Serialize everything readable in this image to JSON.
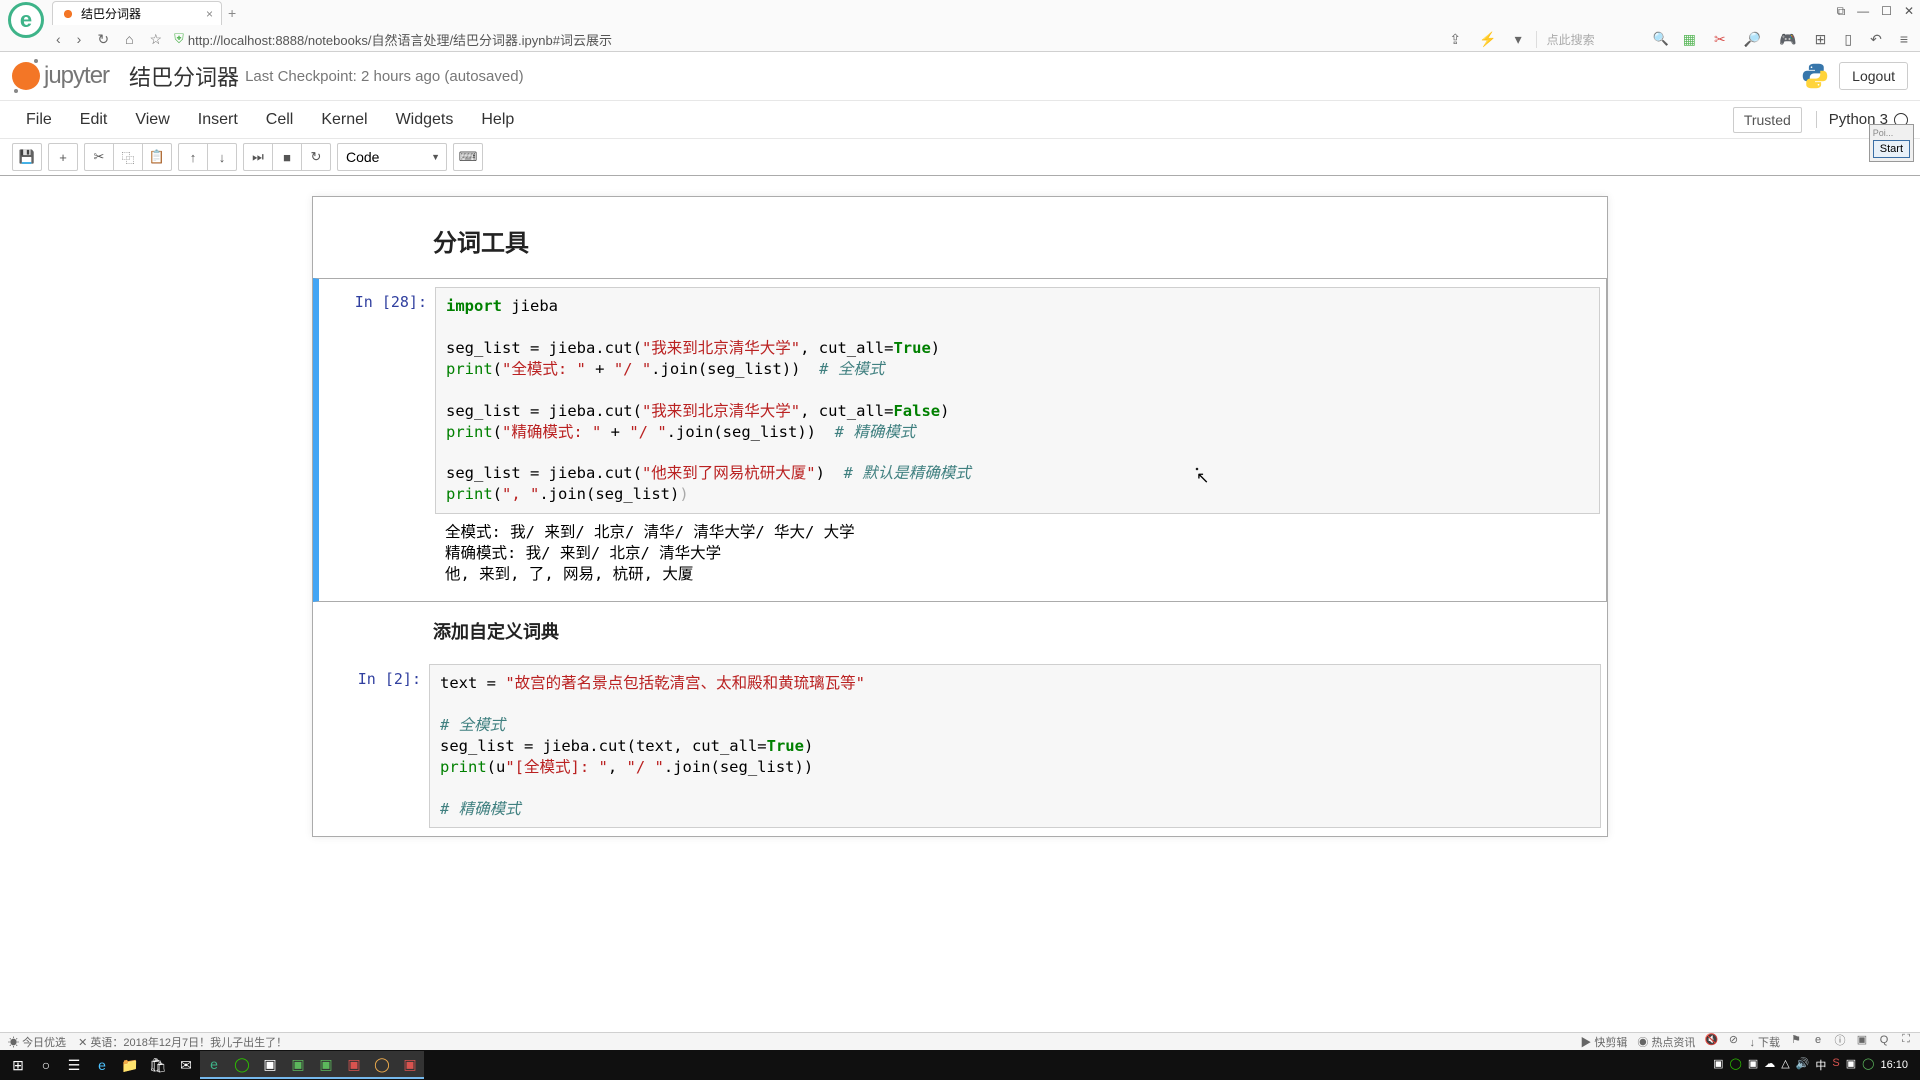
{
  "browser": {
    "tab_title": "结巴分词器",
    "url": "http://localhost:8888/notebooks/自然语言处理/结巴分词器.ipynb#词云展示",
    "search_placeholder": "点此搜索"
  },
  "jupyter": {
    "logo_text": "jupyter",
    "notebook_name": "结巴分词器",
    "checkpoint": "Last Checkpoint: 2 hours ago (autosaved)",
    "logout": "Logout",
    "menus": [
      "File",
      "Edit",
      "View",
      "Insert",
      "Cell",
      "Kernel",
      "Widgets",
      "Help"
    ],
    "trusted": "Trusted",
    "kernel": "Python 3",
    "cell_type": "Code"
  },
  "float": {
    "label": "Poi...",
    "button": "Start"
  },
  "notebook": {
    "heading1": "分词工具",
    "cell1": {
      "prompt": "In [28]:",
      "output": "全模式: 我/ 来到/ 北京/ 清华/ 清华大学/ 华大/ 大学\n精确模式: 我/ 来到/ 北京/ 清华大学\n他, 来到, 了, 网易, 杭研, 大厦"
    },
    "heading2": "添加自定义词典",
    "cell2": {
      "prompt": "In [2]:"
    }
  },
  "code1": {
    "l1a": "import",
    "l1b": " jieba",
    "l3a": "seg_list = jieba.cut(",
    "l3b": "\"我来到北京清华大学\"",
    "l3c": ", cut_all=",
    "l3d": "True",
    "l3e": ")",
    "l4a": "print",
    "l4b": "(",
    "l4c": "\"全模式: \"",
    "l4d": " + ",
    "l4e": "\"/ \"",
    "l4f": ".join(seg_list))  ",
    "l4g": "# 全模式",
    "l6a": "seg_list = jieba.cut(",
    "l6b": "\"我来到北京清华大学\"",
    "l6c": ", cut_all=",
    "l6d": "False",
    "l6e": ")",
    "l7a": "print",
    "l7b": "(",
    "l7c": "\"精确模式: \"",
    "l7d": " + ",
    "l7e": "\"/ \"",
    "l7f": ".join(seg_list))  ",
    "l7g": "# 精确模式",
    "l9a": "seg_list = jieba.cut(",
    "l9b": "\"他来到了网易杭研大厦\"",
    "l9c": ")  ",
    "l9d": "# 默认是精确模式",
    "l10a": "print",
    "l10b": "(",
    "l10c": "\", \"",
    "l10d": ".join(seg_list)",
    "l10e": ")"
  },
  "code2": {
    "l1a": "text = ",
    "l1b": "\"故宫的著名景点包括乾清宫、太和殿和黄琉璃瓦等\"",
    "l3a": "# 全模式",
    "l4a": "seg_list = jieba.cut(text, cut_all=",
    "l4b": "True",
    "l4c": ")",
    "l5a": "print",
    "l5b": "(u",
    "l5c": "\"[全模式]: \"",
    "l5d": ", ",
    "l5e": "\"/ \"",
    "l5f": ".join(seg_list))",
    "l7a": "# 精确模式"
  },
  "statusbar": {
    "left1": "今日优选",
    "left2": "英语：2018年12月7日！我儿子出生了！",
    "r1": "快剪辑",
    "r2": "热点资讯",
    "r3": "下载"
  },
  "taskbar": {
    "time": "16:10"
  }
}
